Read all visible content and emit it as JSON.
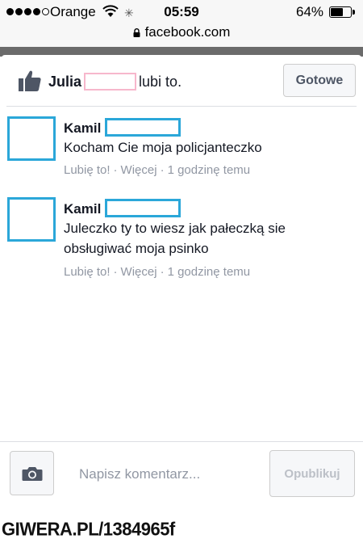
{
  "status_bar": {
    "carrier": "Orange",
    "time": "05:59",
    "battery_percent": "64%",
    "battery_level": 0.64,
    "signal_bars_filled": 4,
    "signal_bars_total": 5
  },
  "url_bar": {
    "url": "facebook.com",
    "icon": "lock-icon"
  },
  "likes": {
    "icon": "thumbs-up-icon",
    "name": "Julia",
    "suffix": "lubi to.",
    "done_label": "Gotowe"
  },
  "comments": [
    {
      "author": "Kamil",
      "text": "Kocham Cie moja policjanteczko",
      "like_label": "Lubię to!",
      "more_label": "Więcej",
      "time": "1 godzinę temu"
    },
    {
      "author": "Kamil",
      "text": "Juleczko ty to wiesz jak pałeczką sie obsługiwać moja psinko",
      "like_label": "Lubię to!",
      "more_label": "Więcej",
      "time": "1 godzinę temu"
    }
  ],
  "composer": {
    "camera_icon": "camera-icon",
    "placeholder": "Napisz komentarz...",
    "post_label": "Opublikuj"
  },
  "watermark": {
    "text": "GIWERA.PL/1384965f"
  },
  "colors": {
    "redaction_blue": "#2ba7d9",
    "redaction_pink": "#f7b7cc",
    "meta_grey": "#9197a3",
    "icon_blue": "#4e5665"
  }
}
